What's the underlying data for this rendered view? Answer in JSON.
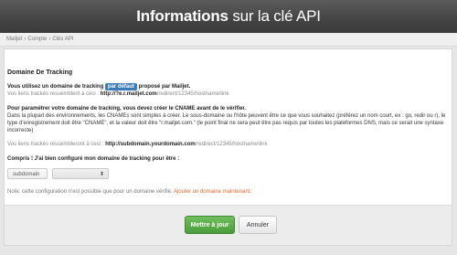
{
  "header": {
    "title_bold": "Informations",
    "title_light": "sur la clé API"
  },
  "breadcrumb": [
    "Mailjet",
    "Compte",
    "Clés API"
  ],
  "tracking": {
    "section_title": "Domaine De Tracking",
    "line1_prefix": "Vous utilisez un domaine de tracking",
    "line1_badge": "par défaut",
    "line1_suffix": "proposé par Mailjet.",
    "line2_prefix": "Vos liens trackés ressemblent à ceci :",
    "line2_url_bold": "http://?e.r.mailjet.com",
    "line2_url_rest": "/redirect/12345/hostname/link",
    "param_title": "Pour paramétrer votre domaine de tracking, vous devez créer le CNAME avant de le vérifier.",
    "param_text": "Dans la plupart des environnements, les CNAMEs sont simples à créer. Le sous-domaine ou l'hôte peuvent être ce que vous souhaitez (préférez un nom court, ex : go, redir ou r), le type d'enregistrement doit être \"CNAME\", et la valeur doit être \"r.mailjet.com.\" (le point final ne sera peut être pas requis par toutes les plateformes DNS, mais ce serait une syntaxe incorrecte)",
    "future_prefix": "Vos liens trackés ressembleront à ceci :",
    "future_url_bold": "http://subdomain.yourdomain.com",
    "future_url_rest": "/redirect/12345/hostname/link",
    "confirm_bold": "Compris ! J'ai bien configuré mon domaine de tracking pour être :",
    "subdomain_placeholder": "subdomain",
    "domain_select_value": "",
    "note_prefix": "Note: cette configuration n'est possible que pour un domaine vérifié.",
    "note_link": "Ajouter un domaine maintenant."
  },
  "footer": {
    "submit_label": "Mettre à jour",
    "cancel_label": "Annuler"
  },
  "colors": {
    "primary_button": "#4b9d3b",
    "badge": "#3a7bb8",
    "link": "#e4662a",
    "header_bg": "#444444"
  }
}
